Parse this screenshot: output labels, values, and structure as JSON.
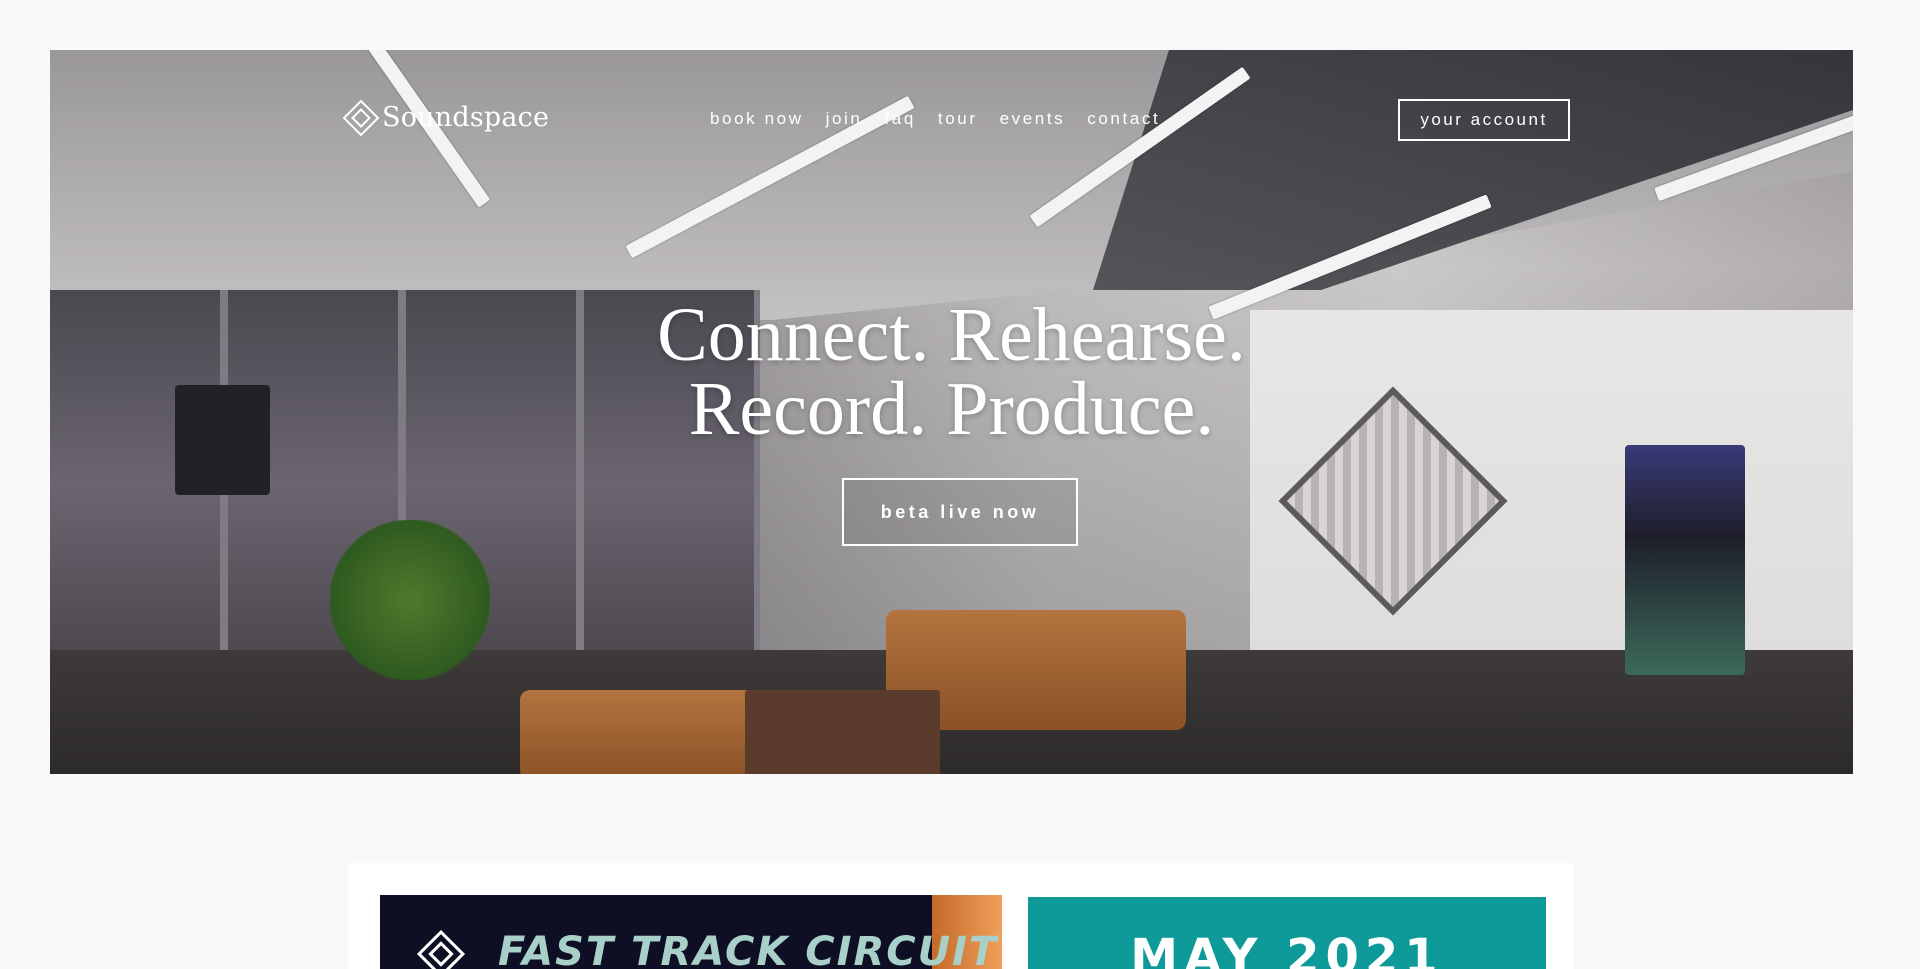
{
  "brand": {
    "name": "Soundspace",
    "logo_icon": "diamond-logo-icon"
  },
  "nav": {
    "links": [
      "book now",
      "join",
      "faq",
      "tour",
      "events",
      "contact"
    ],
    "account_button": "your account"
  },
  "hero": {
    "headline_line1": "Connect. Rehearse.",
    "headline_line2": "Record. Produce.",
    "cta_label": "beta live now"
  },
  "cards": [
    {
      "title": "FAST TRACK CIRCUIT",
      "background": "#0e0f24"
    },
    {
      "title": "MAY 2021",
      "background": "#0f9a9a"
    }
  ],
  "colors": {
    "page_bg": "#f9f9f9",
    "text_on_hero": "#ffffff"
  }
}
